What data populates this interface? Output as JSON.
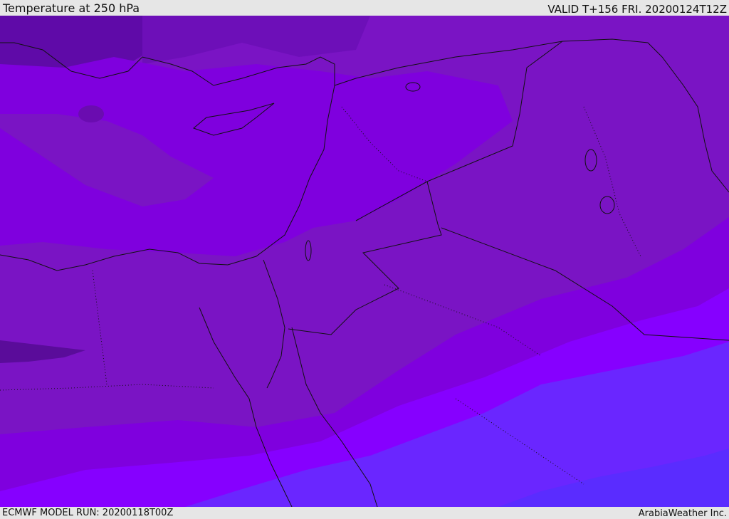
{
  "header": {
    "title": "Temperature at 250 hPa",
    "valid": "VALID T+156 FRI. 20200124T12Z"
  },
  "footer": {
    "model_run": "ECMWF MODEL RUN: 20200118T00Z",
    "credit": "ArabiaWeather Inc."
  },
  "colors": {
    "band_dark": "#5a0c9a",
    "band_deep": "#7a14c4",
    "band_mid": "#7f00de",
    "band_bright": "#8600ff",
    "band_blue_violet": "#6a26ff",
    "band_blue": "#5a2cff",
    "coastline": "#111111"
  }
}
